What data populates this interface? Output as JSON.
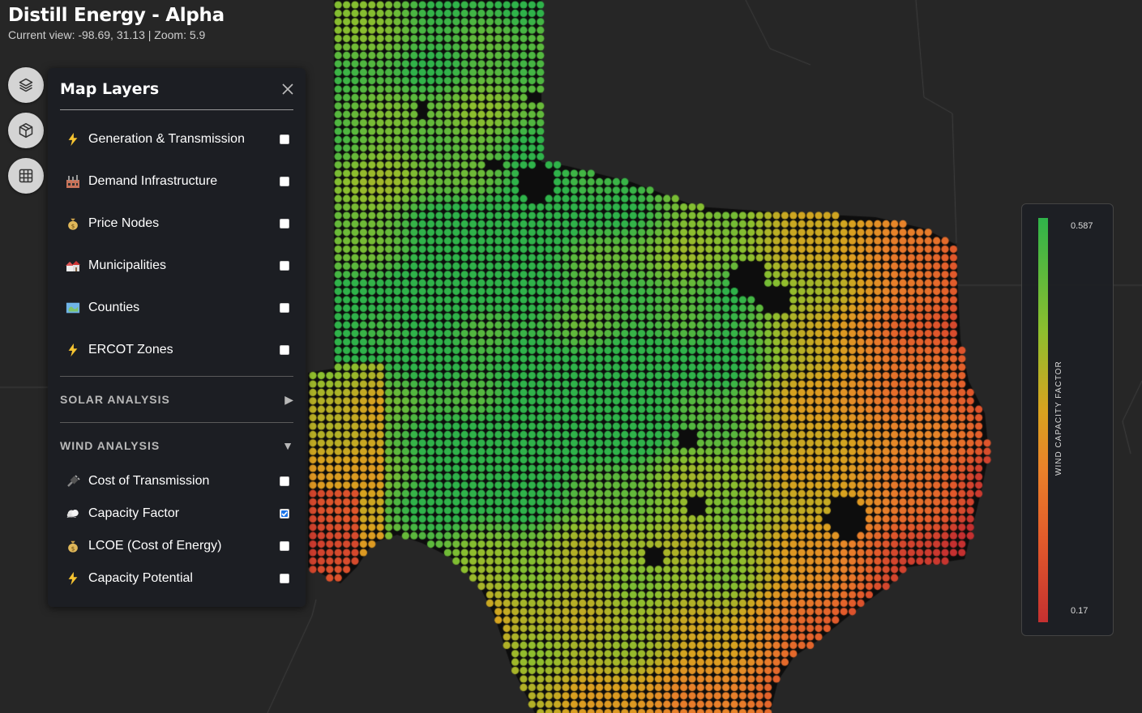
{
  "header": {
    "title": "Distill Energy - Alpha",
    "view_info": "Current view: -98.69, 31.13 | Zoom: 5.9"
  },
  "toolbar": {
    "buttons": [
      {
        "name": "layers-icon"
      },
      {
        "name": "box-icon"
      },
      {
        "name": "grid-icon"
      }
    ]
  },
  "panel": {
    "title": "Map Layers",
    "layers": [
      {
        "label": "Generation & Transmission",
        "icon": "lightning-icon",
        "checked": false
      },
      {
        "label": "Demand Infrastructure",
        "icon": "factory-icon",
        "checked": false
      },
      {
        "label": "Price Nodes",
        "icon": "money-bag-icon",
        "checked": false
      },
      {
        "label": "Municipalities",
        "icon": "houses-icon",
        "checked": false
      },
      {
        "label": "Counties",
        "icon": "map-icon",
        "checked": false
      },
      {
        "label": "ERCOT Zones",
        "icon": "lightning-icon",
        "checked": false
      }
    ],
    "solar_section": {
      "label": "SOLAR ANALYSIS",
      "expanded": false
    },
    "wind_section": {
      "label": "WIND ANALYSIS",
      "expanded": true
    },
    "wind_layers": [
      {
        "label": "Cost of Transmission",
        "icon": "plug-icon",
        "checked": false
      },
      {
        "label": "Capacity Factor",
        "icon": "wind-cloud-icon",
        "checked": true
      },
      {
        "label": "LCOE (Cost of Energy)",
        "icon": "money-bag-icon",
        "checked": false
      },
      {
        "label": "Capacity Potential",
        "icon": "lightning-icon",
        "checked": false
      }
    ]
  },
  "legend": {
    "title": "WIND CAPACITY FACTOR",
    "max": "0.587",
    "min": "0.17",
    "colors": [
      "#2fb34a",
      "#8dbf2e",
      "#d9a21f",
      "#e9822a",
      "#e25a2b",
      "#c43030"
    ]
  }
}
